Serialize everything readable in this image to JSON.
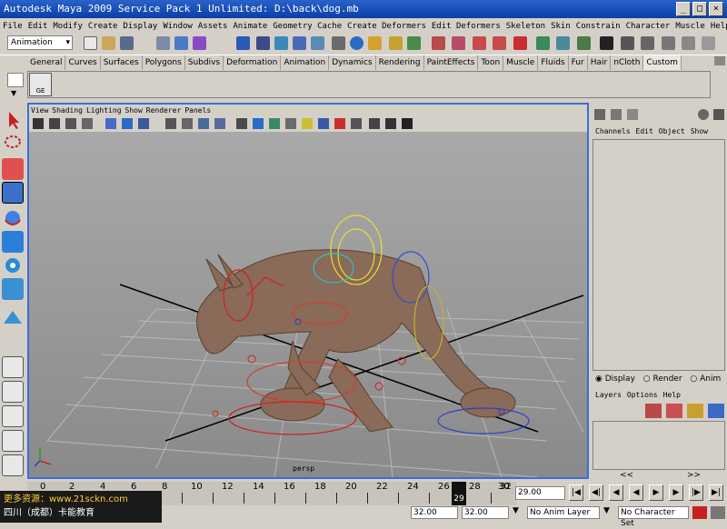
{
  "window": {
    "title": "Autodesk Maya 2009 Service Pack 1 Unlimited: D:\\back\\dog.mb"
  },
  "menubar": [
    "File",
    "Edit",
    "Modify",
    "Create",
    "Display",
    "Window",
    "Assets",
    "Animate",
    "Geometry Cache",
    "Create Deformers",
    "Edit Deformers",
    "Skeleton",
    "Skin",
    "Constrain",
    "Character",
    "Muscle",
    "Help"
  ],
  "status": {
    "mode": "Animation"
  },
  "shelf": {
    "tabs": [
      "General",
      "Curves",
      "Surfaces",
      "Polygons",
      "Subdivs",
      "Deformation",
      "Animation",
      "Dynamics",
      "Rendering",
      "PaintEffects",
      "Toon",
      "Muscle",
      "Fluids",
      "Fur",
      "Hair",
      "nCloth",
      "Custom"
    ],
    "active_tab": "Custom",
    "ge_label": "GE"
  },
  "panel": {
    "menu": [
      "View",
      "Shading",
      "Lighting",
      "Show",
      "Renderer",
      "Panels"
    ],
    "camera_label": "persp"
  },
  "channelbox": {
    "menu": [
      "Channels",
      "Edit",
      "Object",
      "Show"
    ]
  },
  "layers": {
    "radio": [
      "Display",
      "Render",
      "Anim"
    ],
    "selected": "Display",
    "menu": [
      "Layers",
      "Options",
      "Help"
    ],
    "nav_left": "<<",
    "nav_right": ">>"
  },
  "timeline": {
    "ticks": [
      "0",
      "2",
      "4",
      "6",
      "8",
      "10",
      "12",
      "14",
      "16",
      "18",
      "20",
      "22",
      "24",
      "26",
      "28",
      "30",
      "32"
    ],
    "current_frame": "29",
    "current_field": "29.00"
  },
  "range": {
    "start": "32.00",
    "end": "32.00",
    "anim_layer": "No Anim Layer",
    "character_set": "No Character Set"
  },
  "watermark": {
    "line1": "更多资源：www.21sckn.com",
    "line2": "四川（成都）卡能教育"
  },
  "colors": {
    "accent": "#3a6ed8",
    "title": "#0a3fa8",
    "dog": "#8a6a58"
  }
}
